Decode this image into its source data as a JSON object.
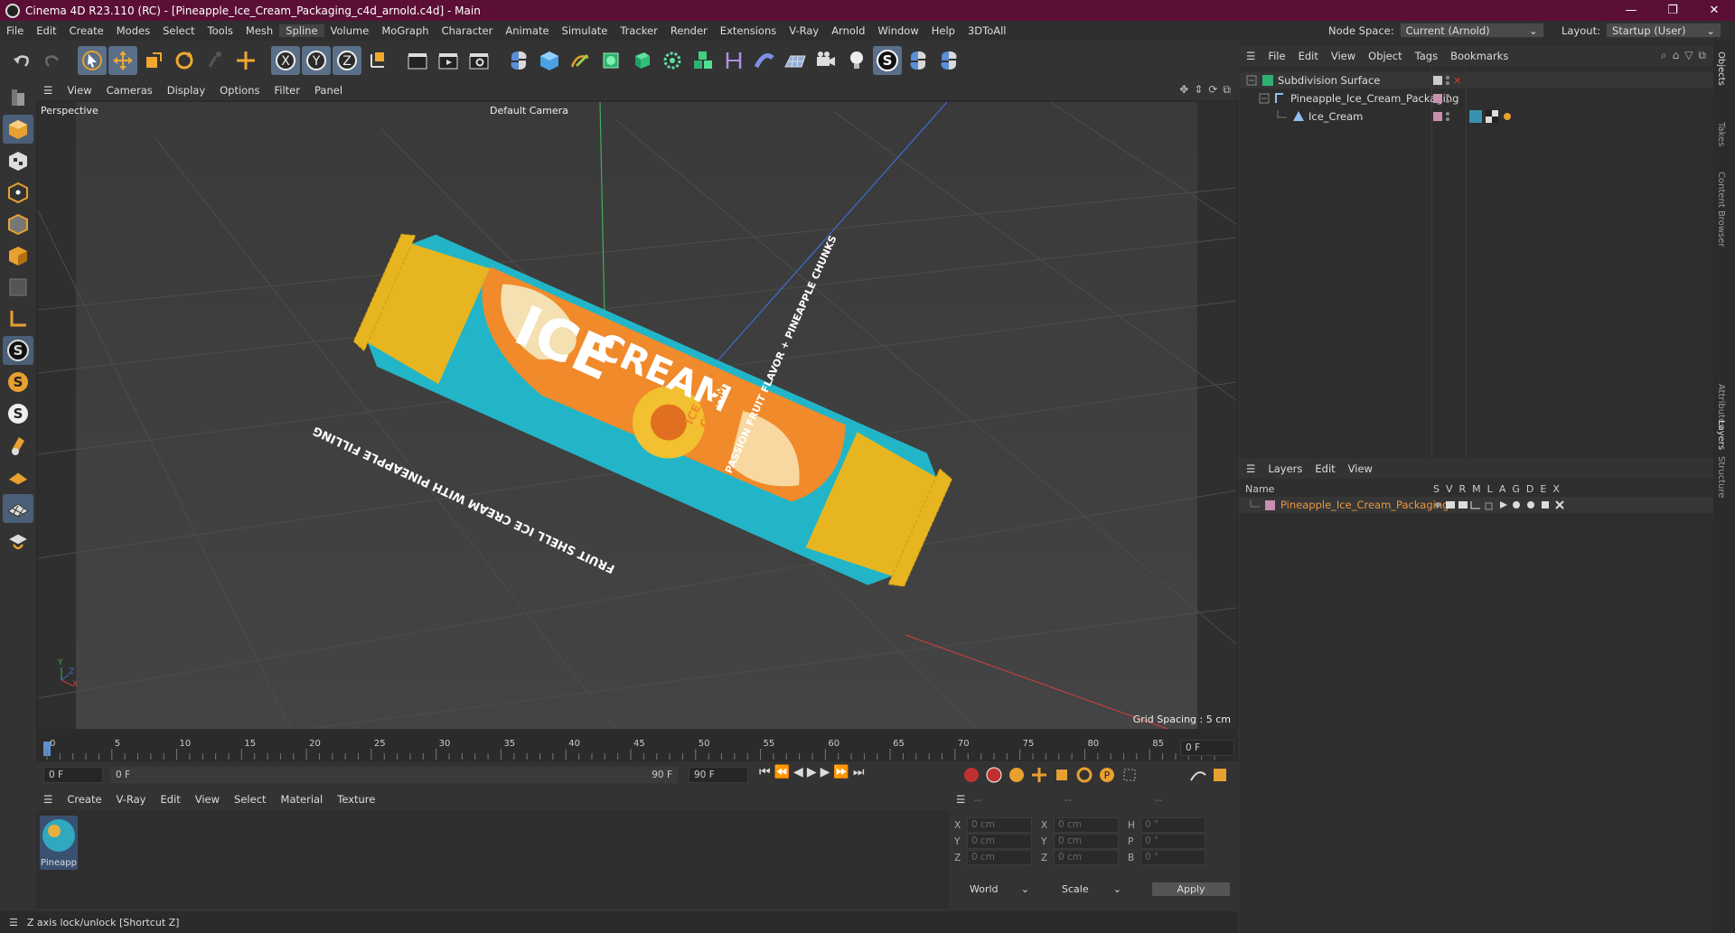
{
  "window": {
    "title": "Cinema 4D R23.110 (RC) - [Pineapple_Ice_Cream_Packaging_c4d_arnold.c4d] - Main",
    "min": "—",
    "max": "❐",
    "close": "✕"
  },
  "menu": [
    "File",
    "Edit",
    "Create",
    "Modes",
    "Select",
    "Tools",
    "Mesh",
    "Spline",
    "Volume",
    "MoGraph",
    "Character",
    "Animate",
    "Simulate",
    "Tracker",
    "Render",
    "Extensions",
    "V-Ray",
    "Arnold",
    "Window",
    "Help",
    "3DToAll"
  ],
  "menu_active": "Spline",
  "nodespace": {
    "label": "Node Space:",
    "value": "Current (Arnold)"
  },
  "layout": {
    "label": "Layout:",
    "value": "Startup (User)"
  },
  "viewport_menu": [
    "View",
    "Cameras",
    "Display",
    "Options",
    "Filter",
    "Panel"
  ],
  "viewport": {
    "view_name": "Perspective",
    "camera": "Default Camera",
    "grid_spacing": "Grid Spacing : 5 cm",
    "axis_y": "Y",
    "axis_x": "X",
    "axis_z": "Z"
  },
  "timeline": {
    "ticks": [
      "0",
      "5",
      "10",
      "15",
      "20",
      "25",
      "30",
      "35",
      "40",
      "45",
      "50",
      "55",
      "60",
      "65",
      "70",
      "75",
      "80",
      "85",
      "90"
    ],
    "current_frame": "0 F"
  },
  "transport": {
    "start": "0 F",
    "range_start": "0 F",
    "range_end": "90 F",
    "end": "90 F"
  },
  "material_menu": [
    "Create",
    "V-Ray",
    "Edit",
    "View",
    "Select",
    "Material",
    "Texture"
  ],
  "materials": [
    {
      "name": "Pineapp"
    }
  ],
  "coords": {
    "header": [
      "--",
      "--",
      "--"
    ],
    "rows": [
      {
        "a": "X",
        "v1": "0 cm",
        "b": "X",
        "v2": "0 cm",
        "c": "H",
        "v3": "0 °"
      },
      {
        "a": "Y",
        "v1": "0 cm",
        "b": "Y",
        "v2": "0 cm",
        "c": "P",
        "v3": "0 °"
      },
      {
        "a": "Z",
        "v1": "0 cm",
        "b": "Z",
        "v2": "0 cm",
        "c": "B",
        "v3": "0 °"
      }
    ],
    "space": "World",
    "mode": "Scale",
    "apply": "Apply"
  },
  "status": "Z axis lock/unlock [Shortcut Z]",
  "objects_menu": [
    "File",
    "Edit",
    "View",
    "Object",
    "Tags",
    "Bookmarks"
  ],
  "objects": [
    {
      "name": "Subdivision Surface",
      "level": 0
    },
    {
      "name": "Pineapple_Ice_Cream_Packaging",
      "level": 1
    },
    {
      "name": "Ice_Cream",
      "level": 2
    }
  ],
  "layers_menu": [
    "Layers",
    "Edit",
    "View"
  ],
  "layer_columns": {
    "name": "Name",
    "flags": [
      "S",
      "V",
      "R",
      "M",
      "L",
      "A",
      "G",
      "D",
      "E",
      "X"
    ]
  },
  "layers": [
    {
      "name": "Pineapple_Ice_Cream_Packaging",
      "color": "#c98fb0"
    }
  ],
  "side_tabs": [
    "Objects",
    "Takes",
    "Content Browser",
    "Attributes",
    "Layers",
    "Structure"
  ],
  "package": {
    "brand": "ICE",
    "product": "CREAM",
    "badge_top": "ICE",
    "badge_bottom": "CREAM",
    "flavor": "PASSION FRUIT FLAVOR + PINEAPPLE CHUNKS",
    "tagline": "FRUIT SHELL ICE CREAM WITH PINEAPPLE FILLING"
  },
  "colors": {
    "title_bar": "#5b0f36",
    "accent": "#5a6f88",
    "layer_name": "#e89a3c"
  }
}
